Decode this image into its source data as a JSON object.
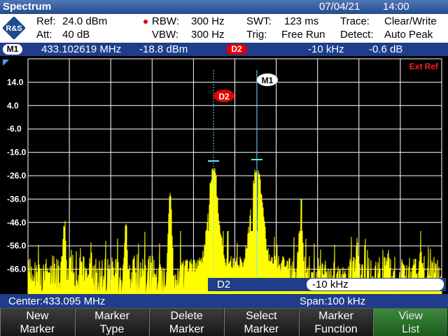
{
  "header": {
    "title": "Spectrum",
    "date": "07/04/21",
    "time": "14:00"
  },
  "settings": {
    "ref": "Ref:",
    "ref_value": "24.0 dBm",
    "att": "Att:",
    "att_value": "40 dB",
    "rbw": "RBW:",
    "rbw_value": "300 Hz",
    "vbw": "VBW:",
    "vbw_value": "300 Hz",
    "swt": "SWT:",
    "swt_value": "123 ms",
    "trig": "Trig:",
    "trig_value": "Free Run",
    "trace": "Trace:",
    "trace_value": "Clear/Write",
    "detect": "Detect:",
    "detect_value": "Auto Peak"
  },
  "marker_bar": {
    "m1_label": "M1",
    "m1_freq": "433.102619  MHz",
    "m1_level": "-18.8  dBm",
    "d2_label": "D2",
    "d2_freq": "-10  kHz",
    "d2_level": "-0.6  dB"
  },
  "plot": {
    "ext_ref": "Ext Ref",
    "y_tick_labels": [
      "14.0",
      "4.0",
      "-6.0",
      "-16.0",
      "-26.0",
      "-36.0",
      "-46.0",
      "-56.0",
      "-66.0"
    ],
    "marker_m1": "M1",
    "marker_d2": "D2",
    "trace_color": "#ffff00",
    "grid_color": "#ffffff"
  },
  "input": {
    "label": "D2",
    "value": "-10 kHz"
  },
  "footer": {
    "center": "Center:433.095 MHz",
    "span": "Span:100 kHz"
  },
  "softkeys": [
    {
      "line1": "New",
      "line2": "Marker"
    },
    {
      "line1": "Marker",
      "line2": "Type"
    },
    {
      "line1": "Delete",
      "line2": "Marker"
    },
    {
      "line1": "Select",
      "line2": "Marker"
    },
    {
      "line1": "Marker",
      "line2": "Function"
    },
    {
      "line1": "View",
      "line2": "List"
    }
  ]
}
